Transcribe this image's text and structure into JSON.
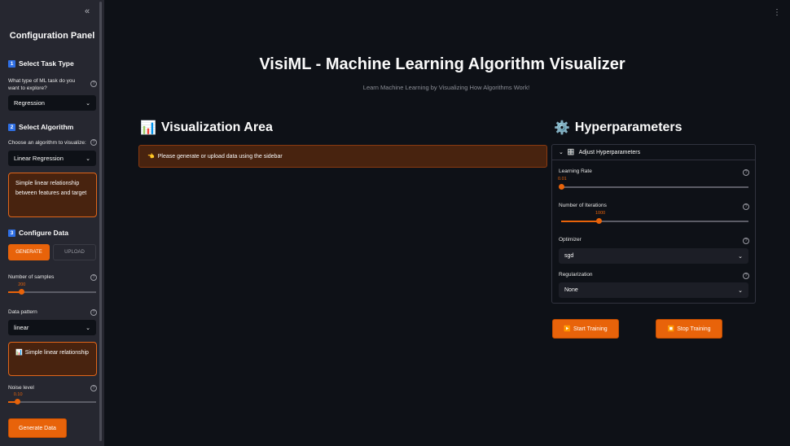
{
  "sidebar": {
    "collapse_icon": "«",
    "title": "Configuration Panel",
    "step1": {
      "num": "1",
      "heading": "Select Task Type"
    },
    "task_question": "What type of ML task do you want to explore?",
    "task_value": "Regression",
    "step2": {
      "num": "2",
      "heading": "Select Algorithm"
    },
    "algorithm_question": "Choose an algorithm to visualize:",
    "algorithm_value": "Linear Regression",
    "algorithm_info": "Simple linear relationship between features and target",
    "step3": {
      "num": "3",
      "heading": "Configure Data"
    },
    "tabs": [
      "GENERATE",
      "UPLOAD"
    ],
    "samples_label": "Number of samples",
    "samples_value": "200",
    "pattern_label": "Data pattern",
    "pattern_value": "linear",
    "pattern_info": "Simple linear relationship",
    "noise_label": "Noise level",
    "noise_value": "0.10",
    "generate_button": "Generate Data",
    "help_glyph": "?",
    "sliders": {
      "samples_fraction": 0.15,
      "noise_fraction": 0.1
    }
  },
  "main": {
    "menu_icon": "⋮",
    "title": "VisiML - Machine Learning Algorithm Visualizer",
    "subtitle": "Learn Machine Learning by Visualizing How Algorithms Work!",
    "viz_heading": "Visualization Area",
    "viz_icon": "📊",
    "alert_icon": "👈",
    "alert_text": "Please generate or upload data using the sidebar"
  },
  "hyperparams": {
    "heading": "Hyperparameters",
    "heading_icon": "⚙️",
    "expander_label": "Adjust Hyperparameters",
    "expander_icon": "🎛️",
    "learning_rate_label": "Learning Rate",
    "learning_rate_value": "0.01",
    "iterations_label": "Number of Iterations",
    "iterations_value": "1000",
    "optimizer_label": "Optimizer",
    "optimizer_value": "sgd",
    "regularization_label": "Regularization",
    "regularization_value": "None",
    "start_button": "Start Training",
    "stop_button": "Stop Training",
    "start_icon": "▶️",
    "stop_icon": "⏹️",
    "sliders": {
      "learning_rate_fraction": 0.0,
      "iterations_fraction": 0.2
    }
  },
  "colors": {
    "accent": "#e8630a",
    "sidebar_bg": "#262730",
    "main_bg": "#0e1117",
    "info_bg": "#48230f"
  }
}
